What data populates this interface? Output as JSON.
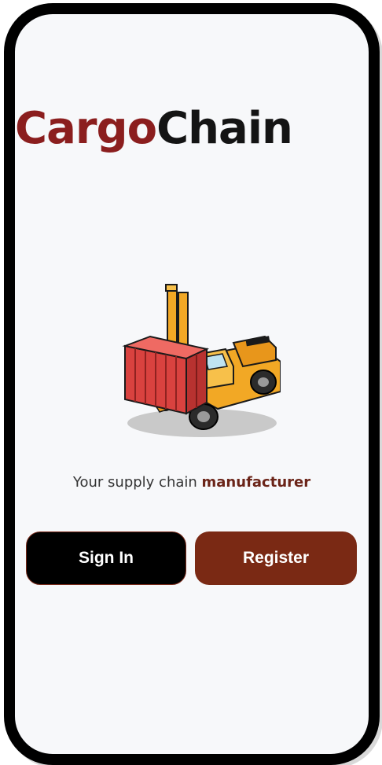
{
  "app": {
    "brand_part1": "Cargo",
    "brand_part2": "Chain",
    "brand_colors": {
      "cargo": "#8b1e1e",
      "chain": "#141414"
    }
  },
  "hero": {
    "illustration": "forklift-with-shipping-container"
  },
  "tagline": {
    "prefix": "Your supply chain ",
    "accent": "manufacturer",
    "accent_color": "#6b2418"
  },
  "actions": {
    "signin_label": "Sign In",
    "register_label": "Register",
    "signin_color": "#000000",
    "register_color": "#7a2914"
  }
}
